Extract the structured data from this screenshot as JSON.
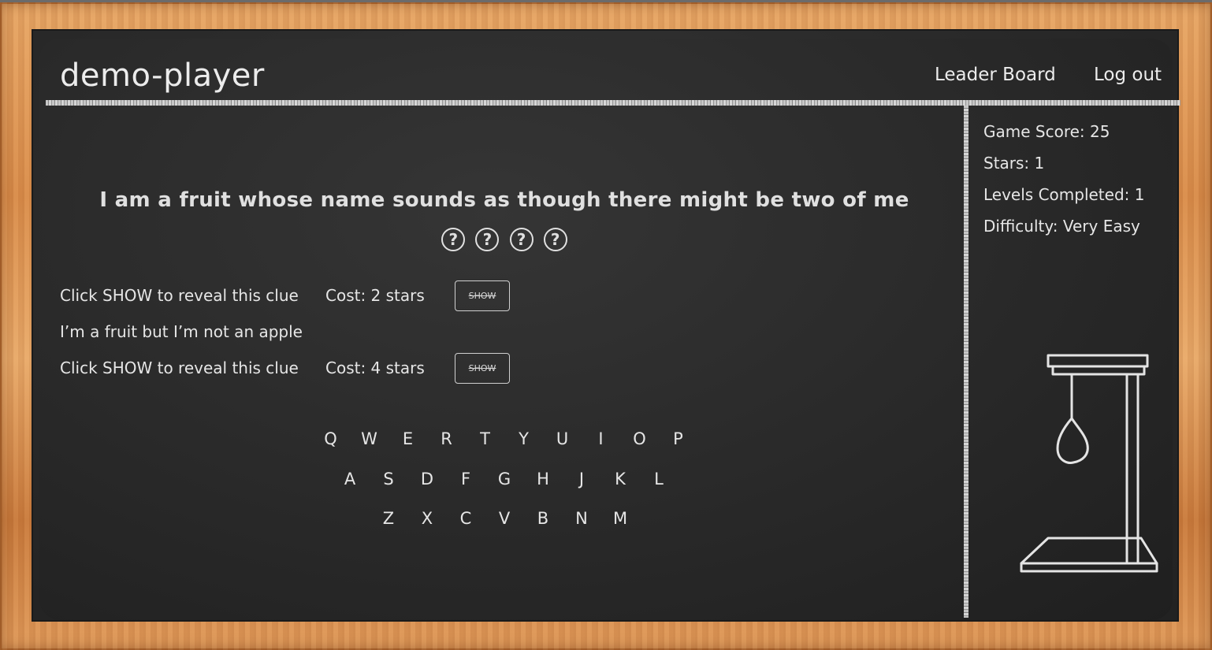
{
  "header": {
    "player_name": "demo-player",
    "nav": {
      "leader_board": "Leader Board",
      "log_out": "Log out"
    }
  },
  "puzzle": {
    "question": "I am a fruit whose name sounds as though there might be two of me",
    "blanks": [
      "?",
      "?",
      "?",
      "?"
    ]
  },
  "clues": [
    {
      "text": "Click SHOW to reveal this clue",
      "cost": "Cost: 2 stars",
      "button": "SHOW"
    },
    {
      "text": "I’m a fruit but I’m not an apple"
    },
    {
      "text": "Click SHOW to reveal this clue",
      "cost": "Cost: 4 stars",
      "button": "SHOW"
    }
  ],
  "keyboard": {
    "row1": [
      "Q",
      "W",
      "E",
      "R",
      "T",
      "Y",
      "U",
      "I",
      "O",
      "P"
    ],
    "row2": [
      "A",
      "S",
      "D",
      "F",
      "G",
      "H",
      "J",
      "K",
      "L"
    ],
    "row3": [
      "Z",
      "X",
      "C",
      "V",
      "B",
      "N",
      "M"
    ]
  },
  "stats": {
    "game_score": "Game Score: 25",
    "stars": "Stars: 1",
    "levels_completed": "Levels Completed: 1",
    "difficulty": "Difficulty: Very Easy"
  },
  "colors": {
    "board": "#2a2a2a",
    "chalk": "#e6e6e6",
    "frame_wood": "#d98c4a"
  }
}
